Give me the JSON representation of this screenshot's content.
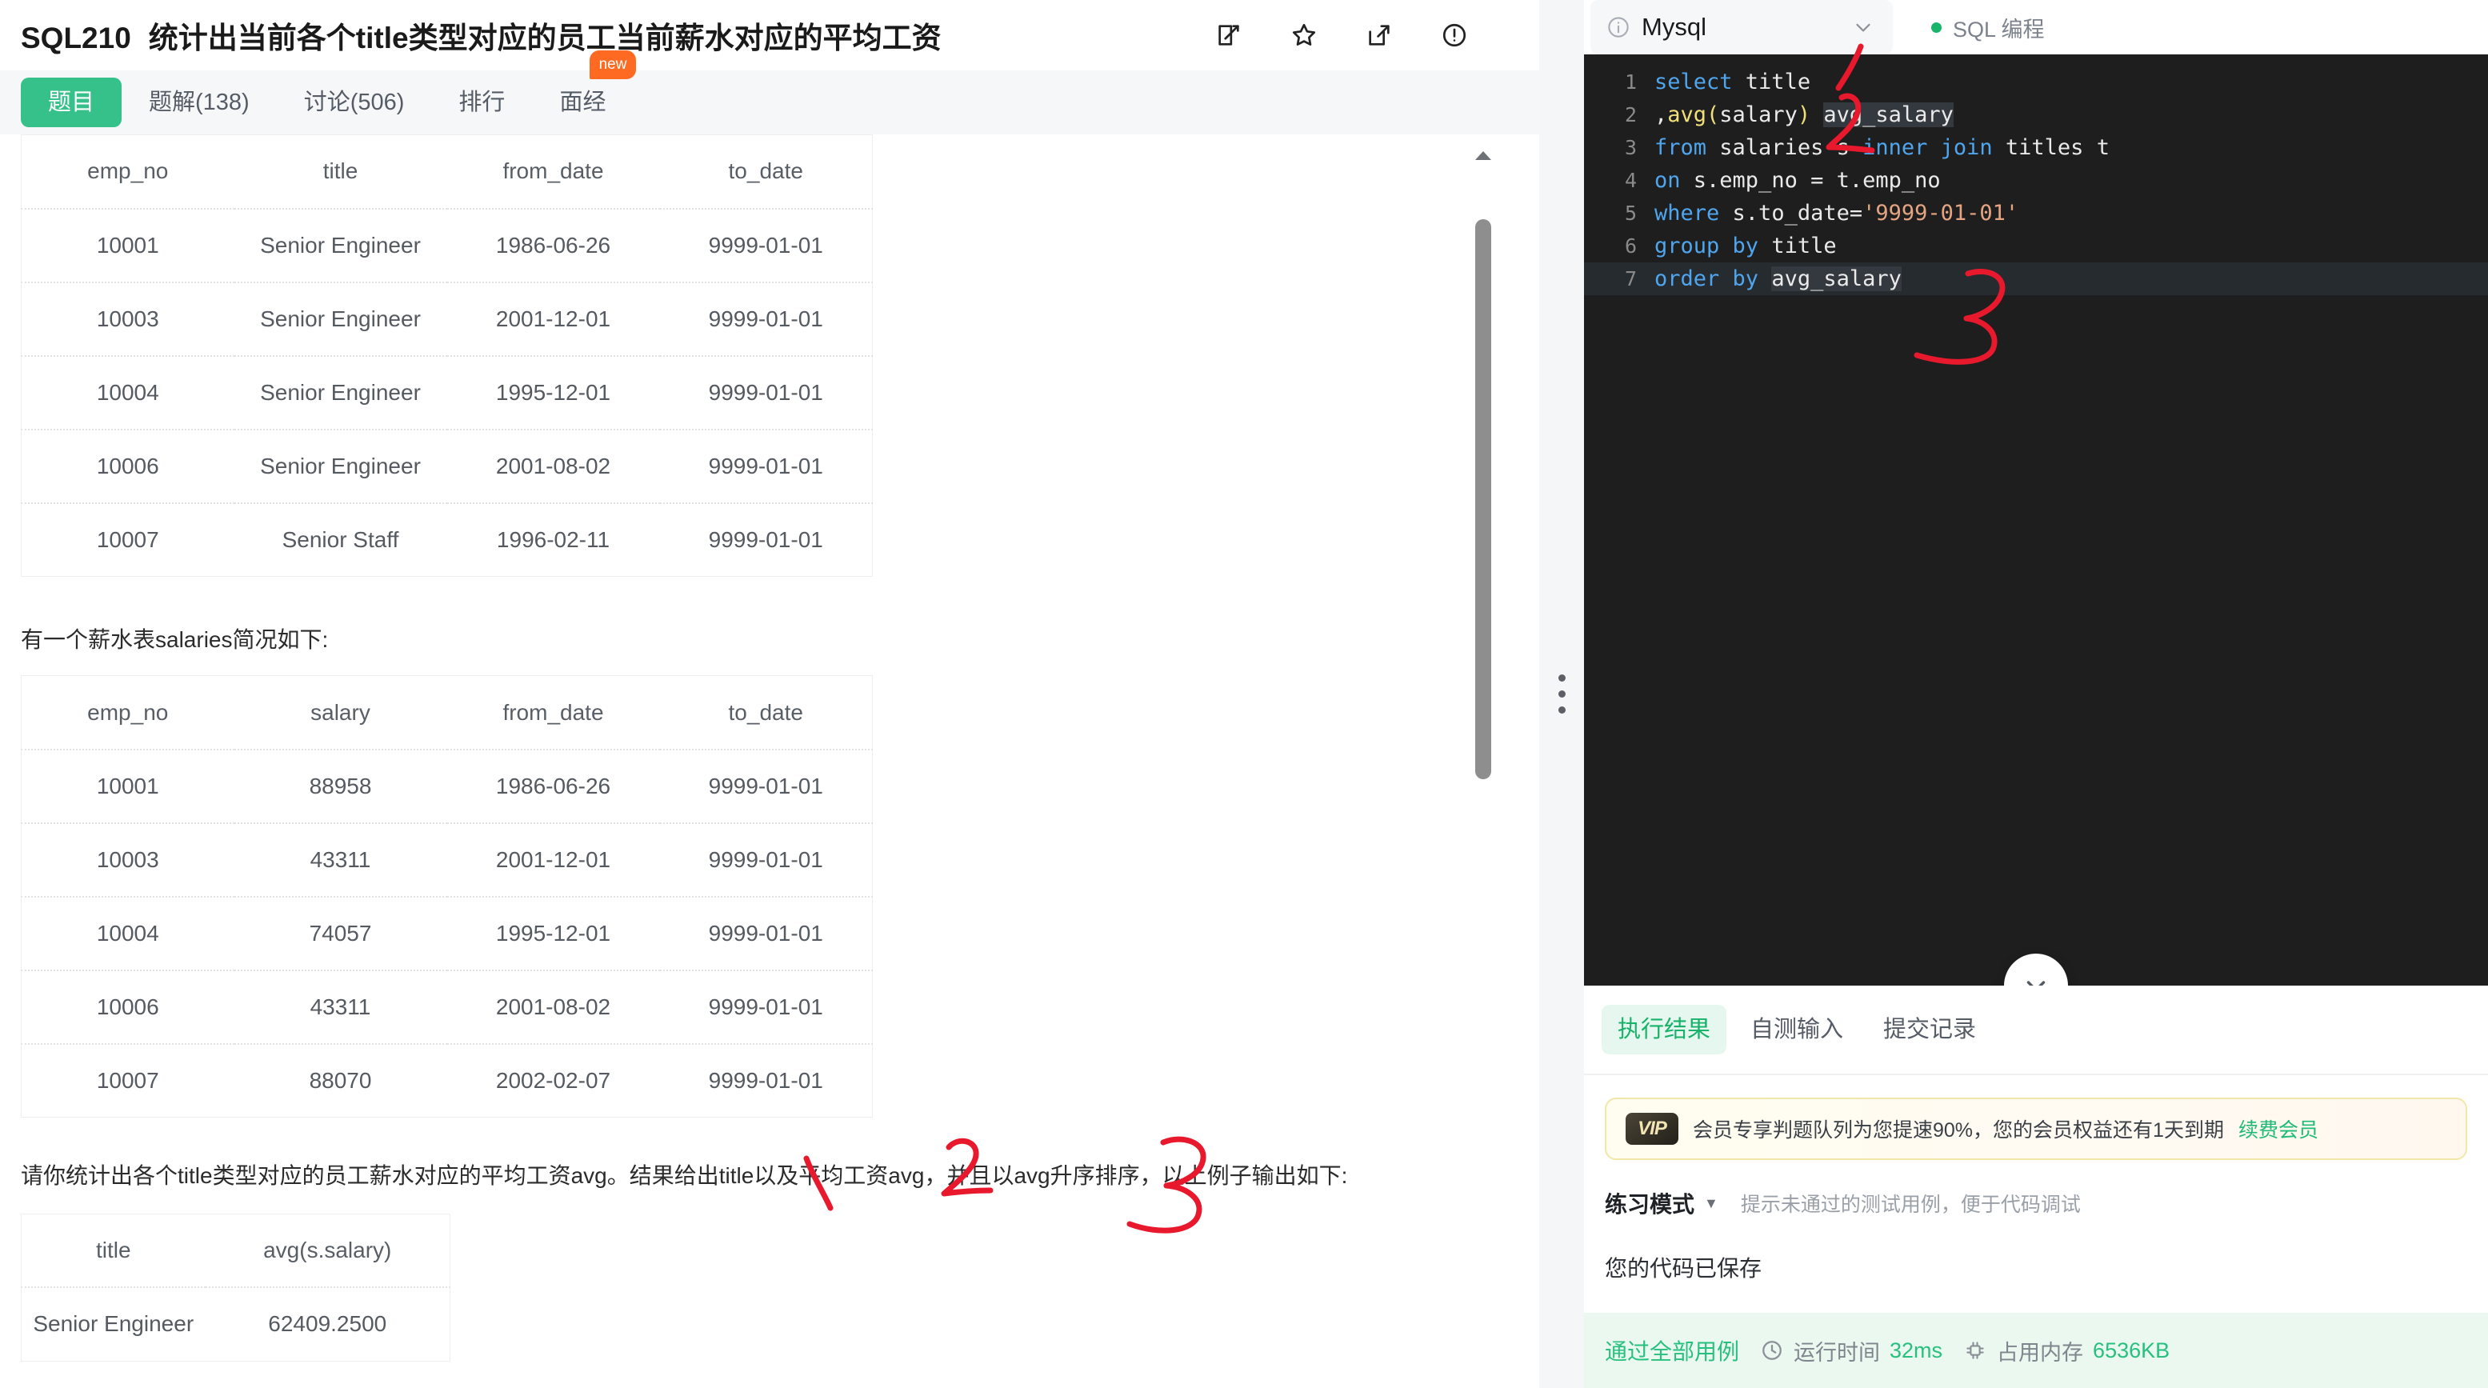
{
  "question": {
    "code": "SQL210",
    "title": "统计出当前各个title类型对应的员工当前薪水对应的平均工资",
    "actions": [
      {
        "name": "note-icon",
        "label": "笔记"
      },
      {
        "name": "star-icon",
        "label": "收藏"
      },
      {
        "name": "share-icon",
        "label": "分享"
      },
      {
        "name": "report-icon",
        "label": "纠错"
      }
    ],
    "tabs": [
      {
        "label": "题目",
        "active": true,
        "badge": null
      },
      {
        "label": "题解(138)",
        "active": false,
        "badge": null
      },
      {
        "label": "讨论(506)",
        "active": false,
        "badge": null
      },
      {
        "label": "排行",
        "active": false,
        "badge": null
      },
      {
        "label": "面经",
        "active": false,
        "badge": "new"
      }
    ],
    "titles_table": {
      "headers": [
        "emp_no",
        "title",
        "from_date",
        "to_date"
      ],
      "rows": [
        [
          "10001",
          "Senior Engineer",
          "1986-06-26",
          "9999-01-01"
        ],
        [
          "10003",
          "Senior Engineer",
          "2001-12-01",
          "9999-01-01"
        ],
        [
          "10004",
          "Senior Engineer",
          "1995-12-01",
          "9999-01-01"
        ],
        [
          "10006",
          "Senior Engineer",
          "2001-08-02",
          "9999-01-01"
        ],
        [
          "10007",
          "Senior Staff",
          "1996-02-11",
          "9999-01-01"
        ]
      ]
    },
    "salaries_intro": "有一个薪水表salaries简况如下:",
    "salaries_table": {
      "headers": [
        "emp_no",
        "salary",
        "from_date",
        "to_date"
      ],
      "rows": [
        [
          "10001",
          "88958",
          "1986-06-26",
          "9999-01-01"
        ],
        [
          "10003",
          "43311",
          "2001-12-01",
          "9999-01-01"
        ],
        [
          "10004",
          "74057",
          "1995-12-01",
          "9999-01-01"
        ],
        [
          "10006",
          "43311",
          "2001-08-02",
          "9999-01-01"
        ],
        [
          "10007",
          "88070",
          "2002-02-07",
          "9999-01-01"
        ]
      ]
    },
    "task_text": "请你统计出各个title类型对应的员工薪水对应的平均工资avg。结果给出title以及平均工资avg，并且以avg升序排序，以上例子输出如下:",
    "output_table": {
      "headers": [
        "title",
        "avg(s.salary)"
      ],
      "rows": [
        [
          "Senior Engineer",
          "62409.2500"
        ]
      ]
    }
  },
  "editor": {
    "language": "Mysql",
    "language_icon": "info-circle-icon",
    "chevron_icon": "chevron-down-icon",
    "mode_label": "SQL 编程",
    "status_dot_color": "#19b46b",
    "collapse_icon": "chevron-down-icon",
    "lines": [
      {
        "n": "1",
        "tokens": [
          {
            "t": "select ",
            "c": "kw"
          },
          {
            "t": "title",
            "c": "txt"
          }
        ]
      },
      {
        "n": "2",
        "tokens": [
          {
            "t": ",",
            "c": "txt"
          },
          {
            "t": "avg",
            "c": "fn"
          },
          {
            "t": "(",
            "c": "fn"
          },
          {
            "t": "salary",
            "c": "txt"
          },
          {
            "t": ")",
            "c": "fn"
          },
          {
            "t": " ",
            "c": "txt"
          },
          {
            "t": "avg_salary",
            "c": "sel"
          }
        ]
      },
      {
        "n": "3",
        "tokens": [
          {
            "t": "from ",
            "c": "kw"
          },
          {
            "t": "salaries s ",
            "c": "txt"
          },
          {
            "t": "inner join ",
            "c": "kw"
          },
          {
            "t": "titles t",
            "c": "txt"
          }
        ]
      },
      {
        "n": "4",
        "tokens": [
          {
            "t": "on ",
            "c": "kw"
          },
          {
            "t": "s.emp_no = t.emp_no",
            "c": "txt"
          }
        ]
      },
      {
        "n": "5",
        "tokens": [
          {
            "t": "where ",
            "c": "kw"
          },
          {
            "t": "s.to_date=",
            "c": "txt"
          },
          {
            "t": "'9999-01-01'",
            "c": "str"
          }
        ]
      },
      {
        "n": "6",
        "tokens": [
          {
            "t": "group by ",
            "c": "kw"
          },
          {
            "t": "title",
            "c": "txt"
          }
        ]
      },
      {
        "n": "7",
        "tokens": [
          {
            "t": "order by ",
            "c": "kw"
          },
          {
            "t": "avg_salary",
            "c": "sel"
          }
        ]
      }
    ]
  },
  "results": {
    "tabs": [
      {
        "label": "执行结果",
        "active": true
      },
      {
        "label": "自测输入",
        "active": false
      },
      {
        "label": "提交记录",
        "active": false
      }
    ],
    "vip": {
      "chip": "VIP",
      "text": "会员专享判题队列为您提速90%，您的会员权益还有1天到期",
      "link": "续费会员"
    },
    "mode": {
      "name": "练习模式",
      "caret_icon": "caret-down-icon",
      "hint": "提示未通过的测试用例，便于代码调试"
    },
    "saved_text": "您的代码已保存",
    "pass": {
      "label": "通过全部用例",
      "time_icon": "clock-icon",
      "time_label": "运行时间",
      "time_value": "32ms",
      "mem_icon": "chip-icon",
      "mem_label": "占用内存",
      "mem_value": "6536KB"
    }
  },
  "annotations": {
    "color": "#e8192c",
    "marks": [
      "1",
      "2",
      "3"
    ]
  }
}
